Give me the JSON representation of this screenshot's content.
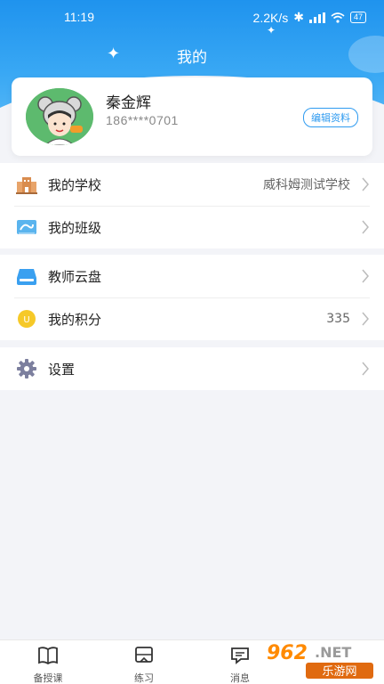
{
  "status": {
    "time": "11:19",
    "speed": "2.2K/s",
    "battery": "47"
  },
  "header": {
    "title": "我的"
  },
  "profile": {
    "name": "秦金辉",
    "phone": "186****0701",
    "edit_label": "编辑资料"
  },
  "menu": {
    "school": {
      "label": "我的学校",
      "value": "威科姆测试学校"
    },
    "class": {
      "label": "我的班级"
    },
    "cloud": {
      "label": "教师云盘"
    },
    "points": {
      "label": "我的积分",
      "value": "335"
    },
    "settings": {
      "label": "设置"
    }
  },
  "tabs": [
    {
      "label": "备授课",
      "icon": "book-icon"
    },
    {
      "label": "练习",
      "icon": "practice-icon"
    },
    {
      "label": "消息",
      "icon": "message-icon"
    }
  ],
  "watermark": {
    "text_top": "962.NET",
    "text_bottom": "乐游网"
  },
  "colors": {
    "accent": "#2f9bf0",
    "header": "#1f93ee",
    "background": "#f3f4f8"
  }
}
